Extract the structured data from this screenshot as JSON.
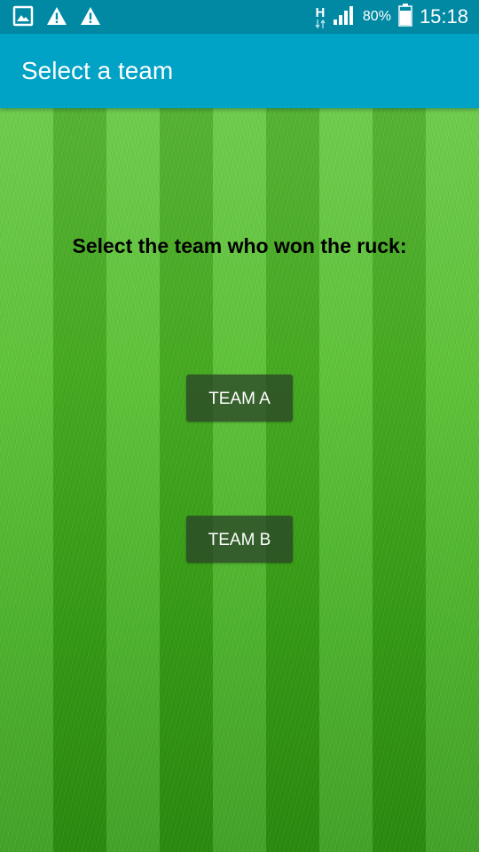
{
  "status_bar": {
    "icons_left": [
      "image-icon",
      "warning-icon",
      "warning-icon"
    ],
    "network_type": "H",
    "battery_percent": "80%",
    "time": "15:18"
  },
  "app_bar": {
    "title": "Select a team"
  },
  "main": {
    "prompt": "Select the team who won the ruck:",
    "buttons": [
      {
        "label": "TEAM A"
      },
      {
        "label": "TEAM B"
      }
    ]
  },
  "colors": {
    "status_bar": "#0189a3",
    "app_bar": "#00a2c5",
    "background": "grass-green"
  }
}
